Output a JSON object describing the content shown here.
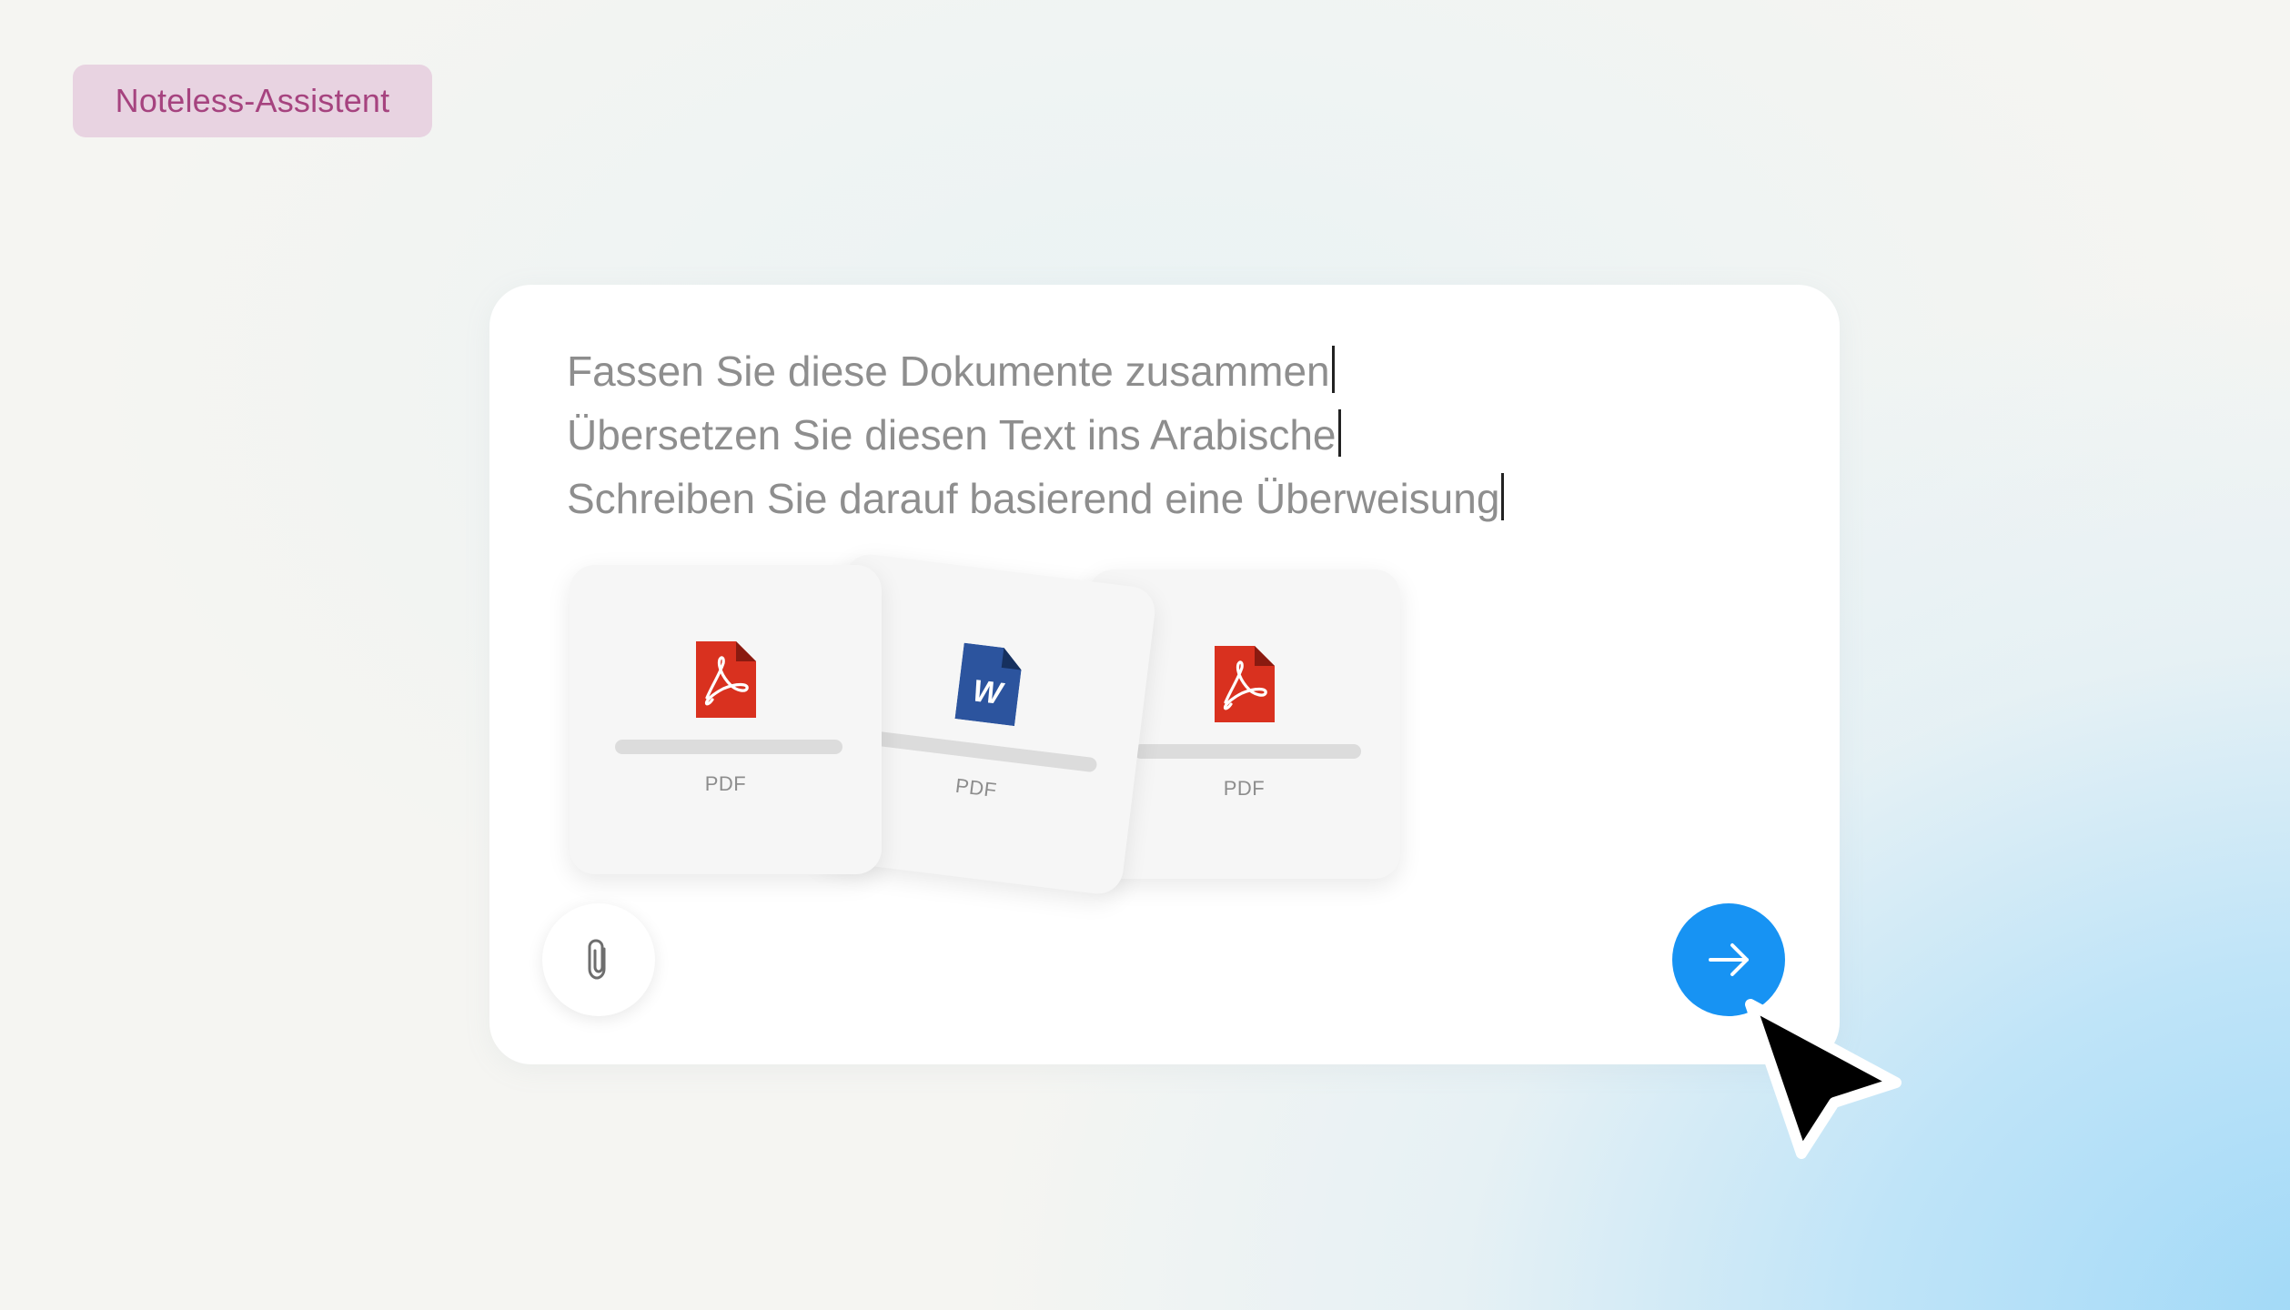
{
  "badge": {
    "label": "Noteless-Assistent"
  },
  "prompts": [
    "Fassen Sie diese Dokumente zusammen",
    "Übersetzen Sie diesen Text ins Arabische",
    "Schreiben Sie darauf basierend eine Überweisung"
  ],
  "attachments": [
    {
      "type": "pdf",
      "icon": "pdf-icon",
      "label": "PDF"
    },
    {
      "type": "word",
      "icon": "word-icon",
      "icon_letter": "W",
      "label": "PDF"
    },
    {
      "type": "pdf",
      "icon": "pdf-icon",
      "label": "PDF"
    }
  ],
  "buttons": {
    "attach_icon": "paperclip-icon",
    "send_icon": "arrow-right-icon"
  },
  "colors": {
    "badge_bg": "#e8d3e1",
    "badge_text": "#a6437f",
    "accent": "#1793f3",
    "pdf_red": "#d9311f",
    "word_blue": "#2c549e",
    "prompt_text": "#8e8e8e"
  }
}
